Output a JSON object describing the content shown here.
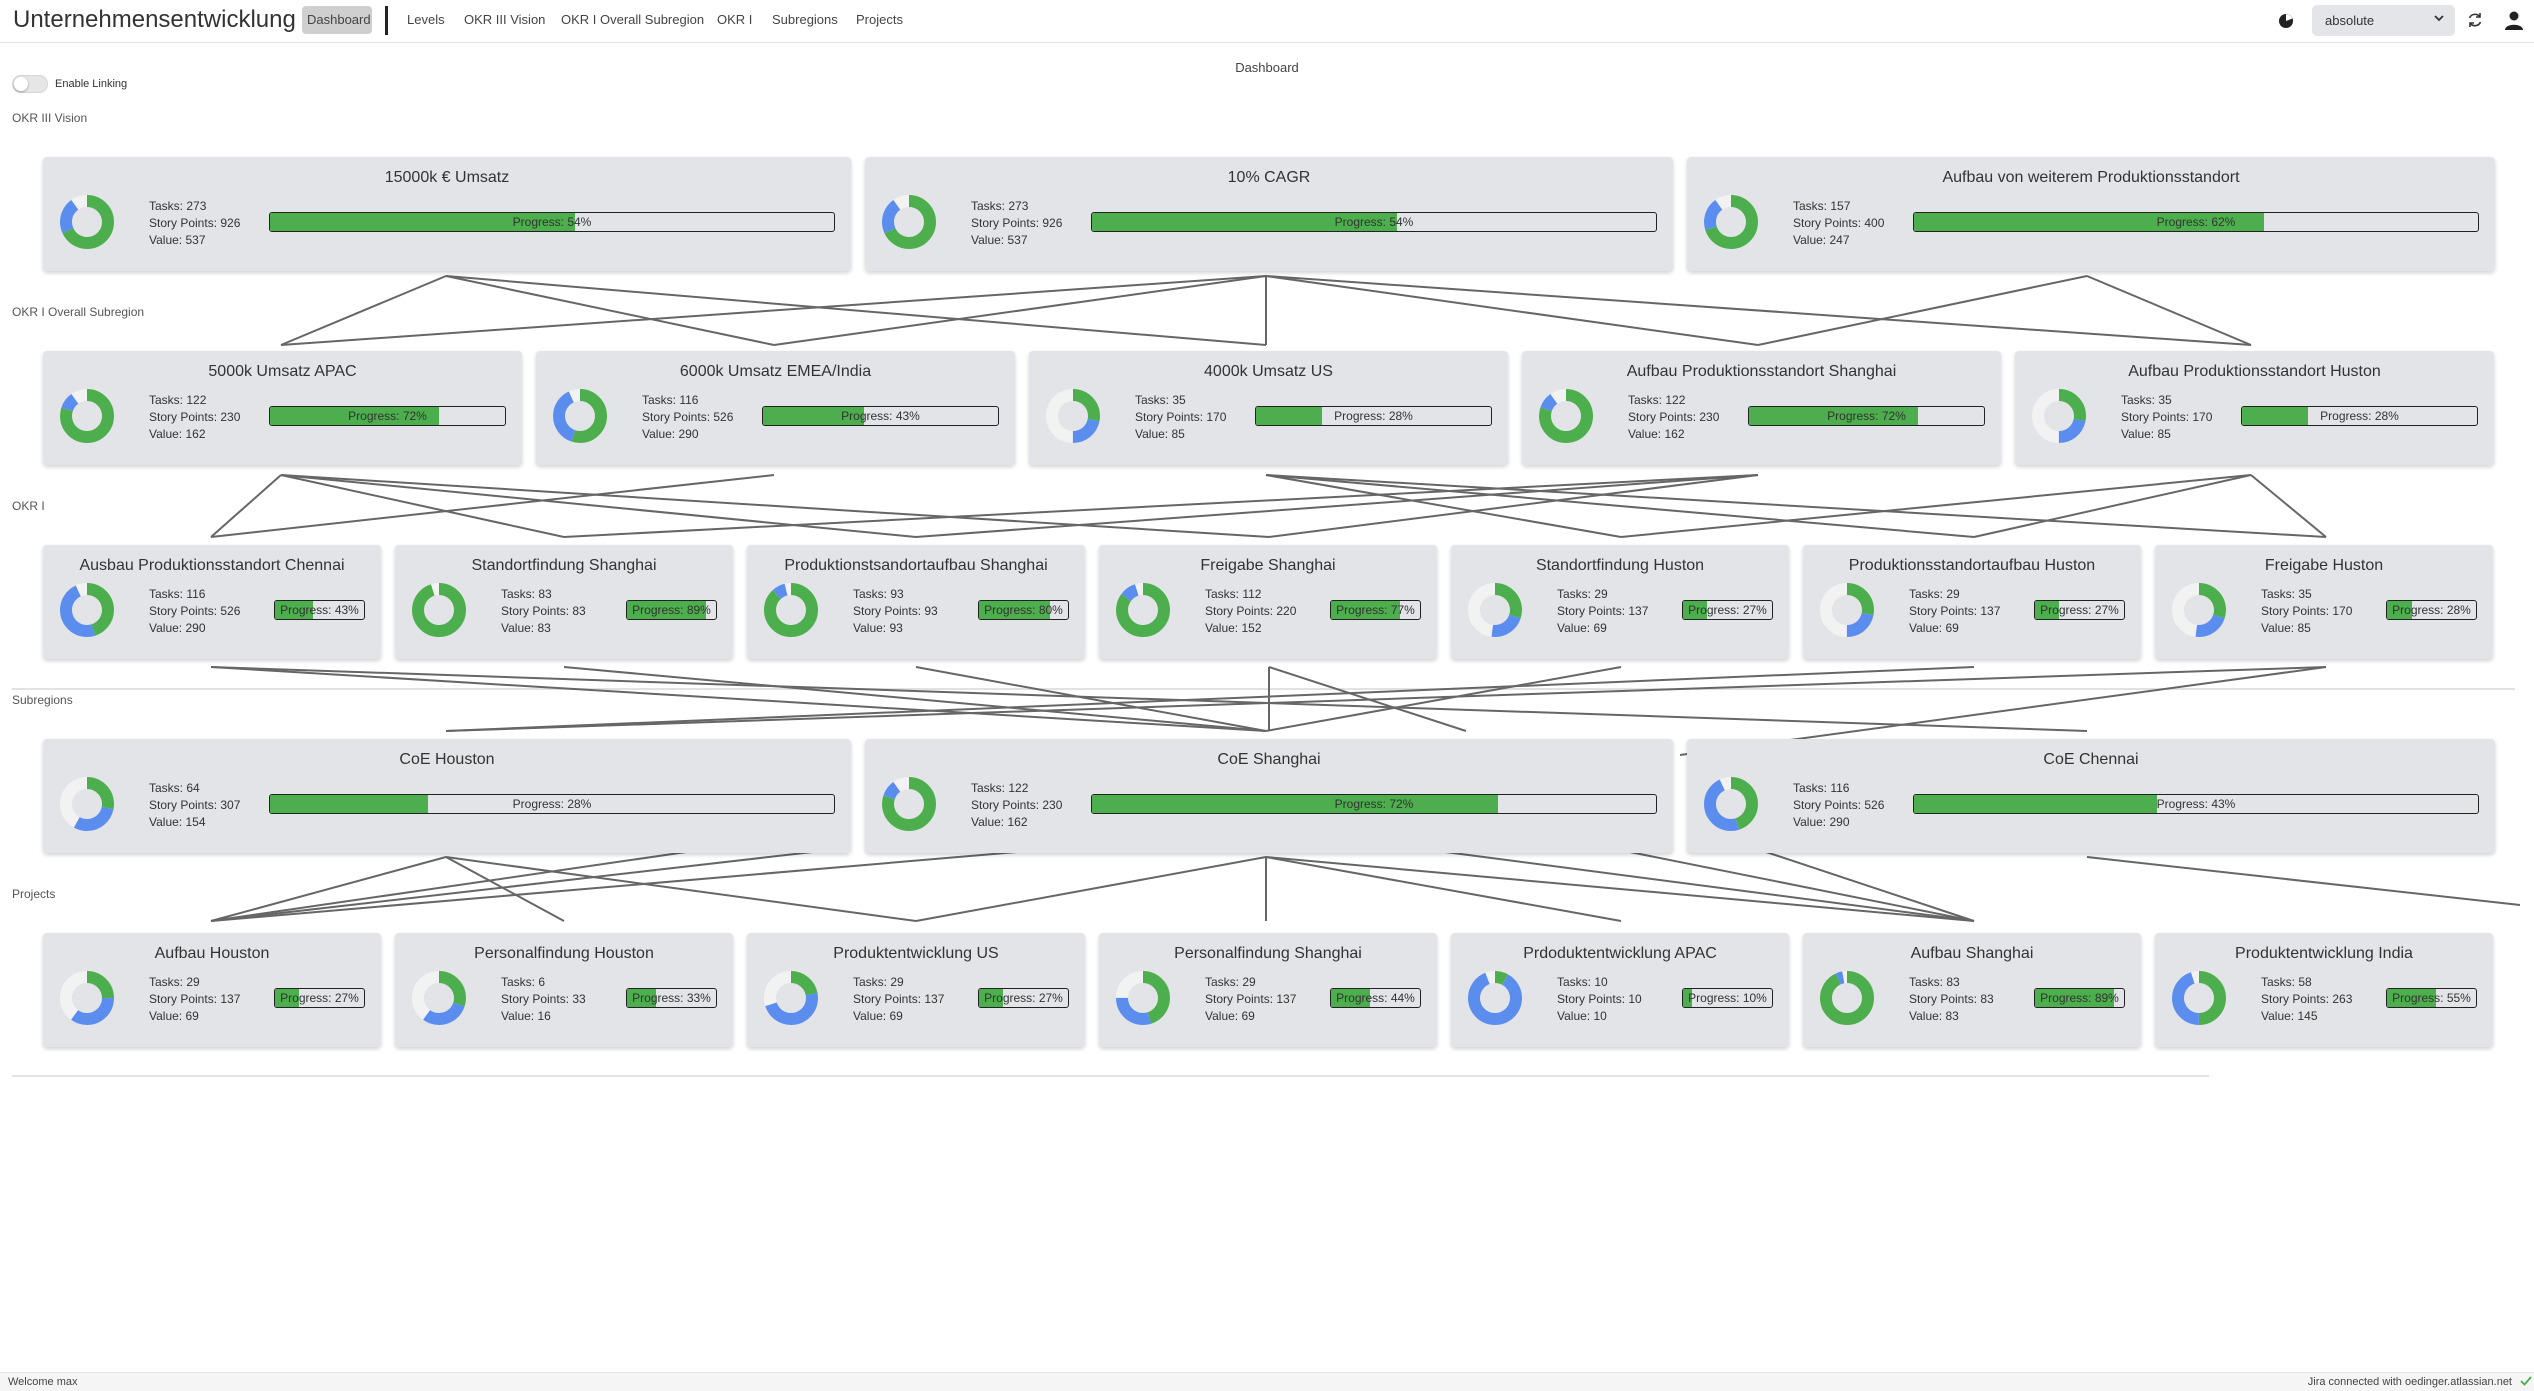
{
  "app": {
    "title": "Unternehmensentwicklung",
    "nav": [
      "Dashboard",
      "Levels",
      "OKR III Vision",
      "OKR I Overall Subregion",
      "OKR I",
      "Subregions",
      "Projects"
    ],
    "mode_select": "absolute"
  },
  "page": {
    "title": "Dashboard",
    "toggle_label": "Enable Linking"
  },
  "labels": {
    "tasks": "Tasks:",
    "story_points": "Story Points:",
    "value": "Value:",
    "progress": "Progress:"
  },
  "colors": {
    "green": "#4cae4c",
    "blue": "#5b8def",
    "card_bg": "#e3e4e8",
    "line": "#666666"
  },
  "levels": [
    {
      "name": "OKR III Vision",
      "cards": [
        {
          "title": "15000k € Umsatz",
          "tasks": 273,
          "story_points": 926,
          "value": 537,
          "progress": 54,
          "donut": [
            0.68,
            0.22
          ]
        },
        {
          "title": "10% CAGR",
          "tasks": 273,
          "story_points": 926,
          "value": 537,
          "progress": 54,
          "donut": [
            0.68,
            0.22
          ]
        },
        {
          "title": "Aufbau von weiterem Produktionsstandort",
          "tasks": 157,
          "story_points": 400,
          "value": 247,
          "progress": 62,
          "donut": [
            0.7,
            0.2
          ]
        }
      ]
    },
    {
      "name": "OKR I Overall Subregion",
      "cards": [
        {
          "title": "5000k Umsatz APAC",
          "tasks": 122,
          "story_points": 230,
          "value": 162,
          "progress": 72,
          "donut": [
            0.8,
            0.1
          ]
        },
        {
          "title": "6000k Umsatz EMEA/India",
          "tasks": 116,
          "story_points": 526,
          "value": 290,
          "progress": 43,
          "donut": [
            0.55,
            0.38
          ]
        },
        {
          "title": "4000k Umsatz US",
          "tasks": 35,
          "story_points": 170,
          "value": 85,
          "progress": 28,
          "donut": [
            0.28,
            0.22
          ]
        },
        {
          "title": "Aufbau Produktionsstandort Shanghai",
          "tasks": 122,
          "story_points": 230,
          "value": 162,
          "progress": 72,
          "donut": [
            0.8,
            0.1
          ]
        },
        {
          "title": "Aufbau Produktionsstandort Huston",
          "tasks": 35,
          "story_points": 170,
          "value": 85,
          "progress": 28,
          "donut": [
            0.28,
            0.22
          ]
        }
      ]
    },
    {
      "name": "OKR I",
      "cards": [
        {
          "title": "Ausbau Produktionsstandort Chennai",
          "tasks": 116,
          "story_points": 526,
          "value": 290,
          "progress": 43,
          "donut": [
            0.45,
            0.48
          ]
        },
        {
          "title": "Standortfindung Shanghai",
          "tasks": 83,
          "story_points": 83,
          "value": 83,
          "progress": 89,
          "donut": [
            0.95,
            0.0
          ]
        },
        {
          "title": "Produktionstsandortaufbau Shanghai",
          "tasks": 93,
          "story_points": 93,
          "value": 93,
          "progress": 80,
          "donut": [
            0.88,
            0.08
          ]
        },
        {
          "title": "Freigabe Shanghai",
          "tasks": 112,
          "story_points": 220,
          "value": 152,
          "progress": 77,
          "donut": [
            0.85,
            0.1
          ]
        },
        {
          "title": "Standortfindung Huston",
          "tasks": 29,
          "story_points": 137,
          "value": 69,
          "progress": 27,
          "donut": [
            0.3,
            0.22
          ]
        },
        {
          "title": "Produktionsstandortaufbau Huston",
          "tasks": 29,
          "story_points": 137,
          "value": 69,
          "progress": 27,
          "donut": [
            0.28,
            0.22
          ]
        },
        {
          "title": "Freigabe Huston",
          "tasks": 35,
          "story_points": 170,
          "value": 85,
          "progress": 28,
          "donut": [
            0.3,
            0.22
          ]
        }
      ]
    },
    {
      "name": "Subregions",
      "cards": [
        {
          "title": "CoE Houston",
          "tasks": 64,
          "story_points": 307,
          "value": 154,
          "progress": 28,
          "donut": [
            0.28,
            0.3
          ]
        },
        {
          "title": "CoE Shanghai",
          "tasks": 122,
          "story_points": 230,
          "value": 162,
          "progress": 72,
          "donut": [
            0.8,
            0.1
          ]
        },
        {
          "title": "CoE Chennai",
          "tasks": 116,
          "story_points": 526,
          "value": 290,
          "progress": 43,
          "donut": [
            0.45,
            0.48
          ]
        }
      ]
    },
    {
      "name": "Projects",
      "cards": [
        {
          "title": "Aufbau Houston",
          "tasks": 29,
          "story_points": 137,
          "value": 69,
          "progress": 27,
          "donut": [
            0.25,
            0.35
          ]
        },
        {
          "title": "Personalfindung Houston",
          "tasks": 6,
          "story_points": 33,
          "value": 16,
          "progress": 33,
          "donut": [
            0.3,
            0.3
          ]
        },
        {
          "title": "Produktentwicklung US",
          "tasks": 29,
          "story_points": 137,
          "value": 69,
          "progress": 27,
          "donut": [
            0.22,
            0.48
          ]
        },
        {
          "title": "Personalfindung Shanghai",
          "tasks": 29,
          "story_points": 137,
          "value": 69,
          "progress": 44,
          "donut": [
            0.45,
            0.3
          ]
        },
        {
          "title": "Prdoduktentwicklung APAC",
          "tasks": 10,
          "story_points": 10,
          "value": 10,
          "progress": 10,
          "donut": [
            0.08,
            0.86
          ]
        },
        {
          "title": "Aufbau Shanghai",
          "tasks": 83,
          "story_points": 83,
          "value": 83,
          "progress": 89,
          "donut": [
            0.93,
            0.04
          ]
        },
        {
          "title": "Produktentwicklung India",
          "tasks": 58,
          "story_points": 263,
          "value": 145,
          "progress": 55,
          "donut": [
            0.5,
            0.45
          ]
        }
      ]
    }
  ],
  "footer": {
    "welcome": "Welcome max",
    "jira": "Jira connected with oedinger.atlassian.net"
  }
}
